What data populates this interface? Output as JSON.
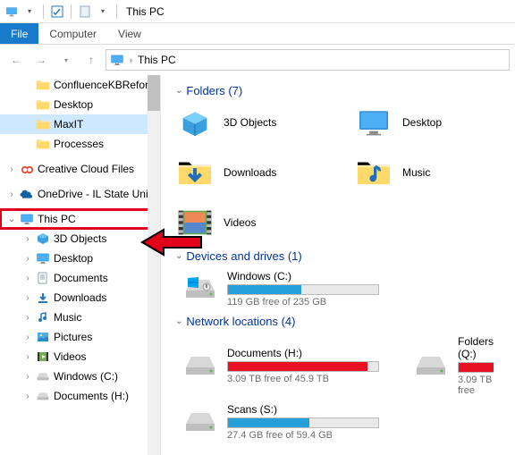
{
  "titlebar": {
    "title": "This PC"
  },
  "ribbon": {
    "file": "File",
    "computer": "Computer",
    "view": "View"
  },
  "address": {
    "crumb1": "This PC"
  },
  "tree": {
    "confluence": "ConfluenceKBReform",
    "desktop": "Desktop",
    "maxit": "MaxIT",
    "processes": "Processes",
    "ccf": "Creative Cloud Files",
    "onedrive": "OneDrive - IL State Univ",
    "thispc": "This PC",
    "t3d": "3D Objects",
    "tdesktop": "Desktop",
    "tdocs": "Documents",
    "tdown": "Downloads",
    "tmusic": "Music",
    "tpics": "Pictures",
    "tvids": "Videos",
    "twinc": "Windows (C:)",
    "tdoch": "Documents (H:)"
  },
  "sections": {
    "folders": "Folders (7)",
    "drives": "Devices and drives (1)",
    "net": "Network locations (4)"
  },
  "folders": {
    "f1": "3D Objects",
    "f2": "Desktop",
    "f3": "Downloads",
    "f4": "Music",
    "f5": "Videos"
  },
  "drives": {
    "c_name": "Windows (C:)",
    "c_free": "119 GB free of 235 GB"
  },
  "net": {
    "h_name": "Documents (H:)",
    "h_free": "3.09 TB free of 45.9 TB",
    "q_name": "Folders (Q:)",
    "q_free": "3.09 TB free",
    "s_name": "Scans (S:)",
    "s_free": "27.4 GB free of 59.4 GB"
  }
}
